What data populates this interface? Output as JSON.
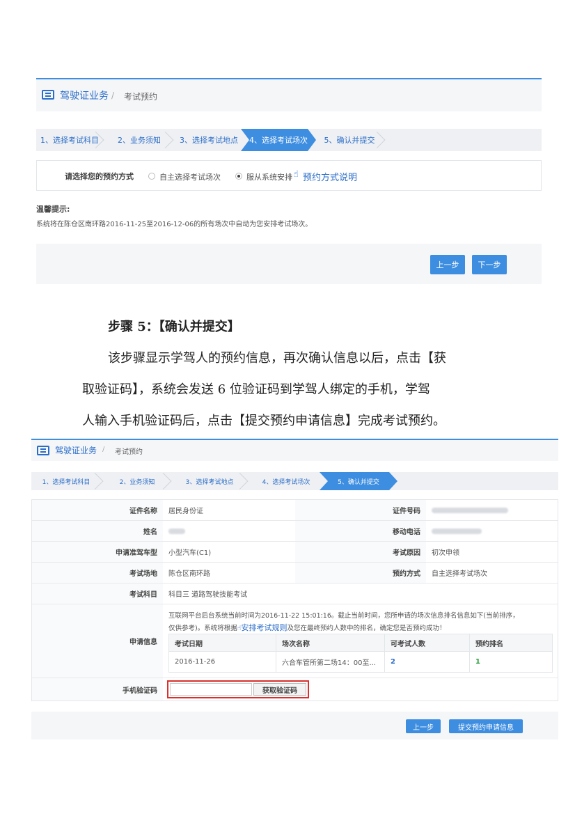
{
  "screen1": {
    "header": {
      "title": "驾驶证业务",
      "separator": "/",
      "subtitle": "考试预约"
    },
    "steps": [
      "1、选择考试科目",
      "2、业务须知",
      "3、选择考试地点",
      "4、选择考试场次",
      "5、确认并提交"
    ],
    "active_step": 4,
    "method": {
      "label": "请选择您的预约方式",
      "option_self": "自主选择考试场次",
      "option_system": "服从系统安排",
      "explain_link": "预约方式说明",
      "selected": "option_system"
    },
    "tip": {
      "title": "温馨提示:",
      "text": "系统将在陈仓区南环路2016-11-25至2016-12-06的所有场次中自动为您安排考试场次。"
    },
    "buttons": {
      "prev": "上一步",
      "next": "下一步"
    }
  },
  "doc": {
    "heading": "步骤 5：【确认并提交】",
    "line1": "该步骤显示学驾人的预约信息，再次确认信息以后，点击【获",
    "line2": "取验证码】，系统会发送 6 位验证码到学驾人绑定的手机，学驾",
    "line3": "人输入手机验证码后，点击【提交预约申请信息】完成考试预约。"
  },
  "screen2": {
    "header": {
      "title": "驾驶证业务",
      "separator": "/",
      "subtitle": "考试预约"
    },
    "steps": [
      "1、选择考试科目",
      "2、业务须知",
      "3、选择考试地点",
      "4、选择考试场次",
      "5、确认并提交"
    ],
    "active_step": 5,
    "form": {
      "id_type_label": "证件名称",
      "id_type": "居民身份证",
      "id_no_label": "证件号码",
      "name_label": "姓名",
      "phone_label": "移动电话",
      "vehicle_label": "申请准驾车型",
      "vehicle": "小型汽车(C1)",
      "reason_label": "考试原因",
      "reason": "初次申领",
      "site_label": "考试场地",
      "site": "陈仓区南环路",
      "mode_label": "预约方式",
      "mode": "自主选择考试场次",
      "subject_label": "考试科目",
      "subject": "科目三 道路驾驶技能考试",
      "apply_label": "申请信息",
      "apply_text1": "互联网平台后台系统当前时间为2016-11-22 15:01:16。截止当前时间，您所申请的场次信息排名信息如下(当前排序，",
      "apply_text2a": "仅供参考)。系统将根据",
      "apply_rule_link": "安排考试规则",
      "apply_text2b": "及您在最终预约人数中的排名，确定您是否预约成功！",
      "table": {
        "headers": [
          "考试日期",
          "场次名称",
          "可考试人数",
          "预约排名"
        ],
        "row": [
          "2016-11-26",
          "六合车管所第二场14：00至...",
          "2",
          "1"
        ]
      },
      "code_label": "手机验证码",
      "code_value": "",
      "get_code": "获取验证码"
    },
    "buttons": {
      "prev": "上一步",
      "submit": "提交预约申请信息"
    }
  }
}
